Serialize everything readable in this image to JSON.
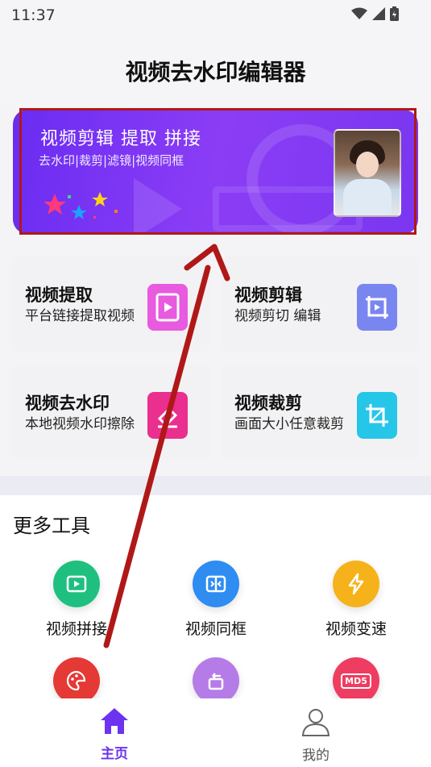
{
  "status_bar": {
    "time": "11:37"
  },
  "header": {
    "title": "视频去水印编辑器"
  },
  "banner": {
    "title": "视频剪辑  提取  拼接",
    "subtitle": "去水印|裁剪|滤镜|视频同框"
  },
  "feature_cards": [
    {
      "title": "视频提取",
      "desc": "平台链接提取视频",
      "icon": "video-file-icon",
      "color": "#e85adf"
    },
    {
      "title": "视频剪辑",
      "desc": "视频剪切 编辑",
      "icon": "crop-frame-icon",
      "color": "#7a86f0"
    },
    {
      "title": "视频去水印",
      "desc": "本地视频水印擦除",
      "icon": "eraser-icon",
      "color": "#ea2f8e"
    },
    {
      "title": "视频裁剪",
      "desc": "画面大小任意裁剪",
      "icon": "crop-icon",
      "color": "#26c6e8"
    }
  ],
  "more_tools": {
    "title": "更多工具",
    "items": [
      {
        "label": "视频拼接",
        "icon": "video-join-icon",
        "color": "#1fc07f"
      },
      {
        "label": "视频同框",
        "icon": "split-frame-icon",
        "color": "#2f8cf0"
      },
      {
        "label": "视频变速",
        "icon": "lightning-icon",
        "color": "#f6b21a"
      },
      {
        "label": "",
        "icon": "palette-icon",
        "color": "#e53935"
      },
      {
        "label": "",
        "icon": "rotate-icon",
        "color": "#b57ce8"
      },
      {
        "label": "",
        "icon": "md5-icon",
        "color": "#ef3d62",
        "icon_text": "MD5"
      }
    ]
  },
  "tab_bar": {
    "items": [
      {
        "label": "主页",
        "active": true,
        "color": "#6c33f0"
      },
      {
        "label": "我的",
        "active": false,
        "color": "#555555"
      }
    ]
  }
}
